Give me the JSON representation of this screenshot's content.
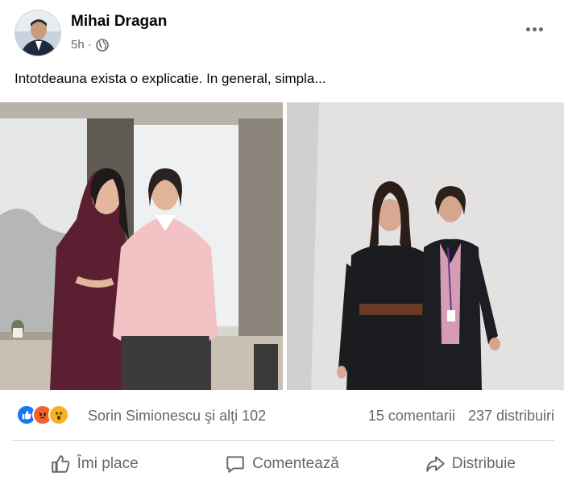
{
  "post": {
    "author": "Mihai Dragan",
    "time": "5h ·",
    "privacy_icon": "globe-icon",
    "text": "Intotdeauna exista o explicatie. In general, simpla..."
  },
  "photos": [
    {
      "name": "photo-office-window"
    },
    {
      "name": "photo-white-wall"
    }
  ],
  "reactions": {
    "icons": [
      "like-icon",
      "angry-icon",
      "wow-icon"
    ],
    "names": "Sorin Simionescu şi alţi 102",
    "comments": "15 comentarii",
    "shares": "237 distribuiri"
  },
  "actions": {
    "like": "Îmi place",
    "comment": "Comentează",
    "share": "Distribuie"
  },
  "colors": {
    "like_blue": "#1877f2",
    "angry_orange": "#f0632b",
    "wow_yellow": "#f7b125",
    "text_secondary": "#65676b"
  }
}
